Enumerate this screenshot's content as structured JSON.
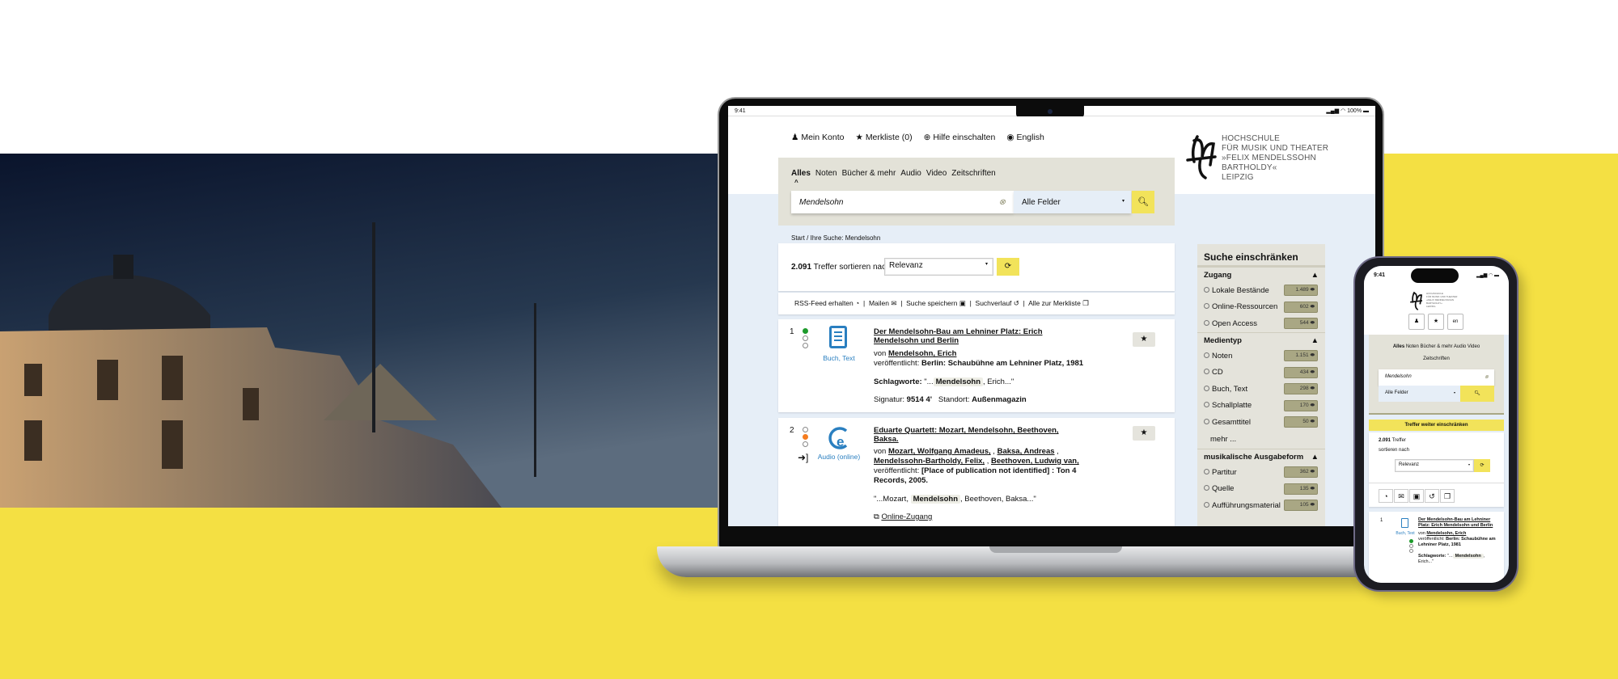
{
  "colors": {
    "brand_yellow": "#f4e043",
    "button_yellow": "#f2e35a",
    "facet_bg": "#e4e3db",
    "count_badge": "#a9a784",
    "page_bg": "#e6eef7",
    "availability_green": "#1e9a2c",
    "availability_orange": "#f57c1f",
    "link_blue": "#2a7fc0"
  },
  "laptop": {
    "status": {
      "time": "9:41",
      "battery": "100%"
    },
    "nav": [
      {
        "icon": "user-icon",
        "label": "Mein Konto"
      },
      {
        "icon": "star-icon",
        "label": "Merkliste (0)"
      },
      {
        "icon": "lifebuoy-icon",
        "label": "Hilfe einschalten"
      },
      {
        "icon": "globe-icon",
        "label": "English"
      }
    ],
    "logo": [
      "HOCHSCHULE",
      "FÜR MUSIK UND THEATER",
      "»FELIX MENDELSSOHN",
      "BARTHOLDY«",
      "LEIPZIG"
    ],
    "search": {
      "tabs": [
        "Alles",
        "Noten",
        "Bücher & mehr",
        "Audio",
        "Video",
        "Zeitschriften"
      ],
      "active_tab": "Alles",
      "query": "Mendelsohn",
      "field": "Alle Felder"
    },
    "breadcrumb": {
      "home": "Start",
      "separator": "/",
      "current": "Ihre Suche: Mendelsohn"
    },
    "results_header": {
      "count": "2.091",
      "text": "Treffer sortieren nach",
      "sort": "Relevanz"
    },
    "actions": [
      "RSS-Feed erhalten",
      "Mailen",
      "Suche speichern",
      "Suchverlauf",
      "Alle zur Merkliste"
    ],
    "results": [
      {
        "number": "1",
        "type": "Buch, Text",
        "title": [
          "Der Mendelsohn-Bau am Lehniner Platz: Erich",
          "Mendelsohn und Berlin"
        ],
        "by_label": "von",
        "authors": "Mendelsohn, Erich",
        "published_label": "veröffentlicht:",
        "published": "Berlin: Schaubühne am Lehniner Platz, 1981",
        "keywords_label": "Schlagworte:",
        "kw_pre": "\"...",
        "kw_hit": "Mendelsohn",
        "kw_post": ", Erich...\"",
        "signatur_label": "Signatur:",
        "signatur": "9514 4'",
        "standort_label": "Standort:",
        "standort": "Außenmagazin",
        "availability": "green"
      },
      {
        "number": "2",
        "type": "Audio (online)",
        "title": [
          "Eduarte Quartett: Mozart, Mendelsohn, Beethoven,",
          "Baksa."
        ],
        "by_label": "von",
        "authors_1": "Mozart, Wolfgang Amadeus,",
        "authors_2": "Baksa, Andreas",
        "authors_3": "Mendelssohn-Bartholdy, Felix,",
        "authors_4": "Beethoven, Ludwig van,",
        "published_label": "veröffentlicht:",
        "published_1": "[Place of publication not identified] : Ton 4",
        "published_2": "Records, 2005.",
        "kw_pre": "\"...Mozart,",
        "kw_hit": "Mendelsohn",
        "kw_post": ", Beethoven, Baksa...\"",
        "online_link": "Online-Zugang",
        "availability": "orange"
      }
    ],
    "facets": {
      "title": "Suche einschränken",
      "groups": [
        {
          "title": "Zugang",
          "items": [
            {
              "label": "Lokale Bestände",
              "count": "1.489"
            },
            {
              "label": "Online-Ressourcen",
              "count": "602"
            },
            {
              "label": "Open Access",
              "count": "544"
            }
          ]
        },
        {
          "title": "Medientyp",
          "items": [
            {
              "label": "Noten",
              "count": "1.151"
            },
            {
              "label": "CD",
              "count": "434"
            },
            {
              "label": "Buch, Text",
              "count": "298"
            },
            {
              "label": "Schallplatte",
              "count": "170"
            },
            {
              "label": "Gesamttitel",
              "count": "50"
            }
          ],
          "more": "mehr ..."
        },
        {
          "title": "musikalische Ausgabeform",
          "items": [
            {
              "label": "Partitur",
              "count": "362"
            },
            {
              "label": "Quelle",
              "count": "135"
            },
            {
              "label": "Aufführungsmaterial",
              "count": "105"
            }
          ]
        }
      ]
    }
  },
  "phone": {
    "status": {
      "time": "9:41"
    },
    "logo": [
      "HOCHSCHULE",
      "FÜR MUSIK UND THEATER",
      "»FELIX MENDELSSOHN",
      "BARTHOLDY«",
      "LEIPZIG"
    ],
    "buttons": {
      "account": "user-icon",
      "list": "star-icon",
      "language": "en"
    },
    "tabs_row1": [
      "Alles",
      "Noten",
      "Bücher & mehr",
      "Audio",
      "Video"
    ],
    "tabs_row2": "Zeitschriften",
    "query": "Mendelsohn",
    "field": "Alle Felder",
    "refine": "Treffer weiter einschränken",
    "count": "2.091",
    "count_label": "Treffer",
    "sort_label": "sortieren nach",
    "sort": "Relevanz",
    "action_icons": [
      "rss-icon",
      "mail-icon",
      "save-icon",
      "history-icon",
      "copy-icon"
    ],
    "result": {
      "number": "1",
      "type": "Buch, Text",
      "title": "Der Mendelsohn-Bau am Lehniner Platz: Erich Mendelsohn und Berlin",
      "by_label": "von",
      "authors": "Mendelsohn, Erich",
      "published_label": "veröffentlicht:",
      "published": "Berlin: Schaubühne am Lehniner Platz, 1981",
      "keywords_label": "Schlagworte:",
      "kw_pre": "\"...",
      "kw_hit": "Mendelsohn",
      "kw_post": ", Erich...\""
    }
  }
}
